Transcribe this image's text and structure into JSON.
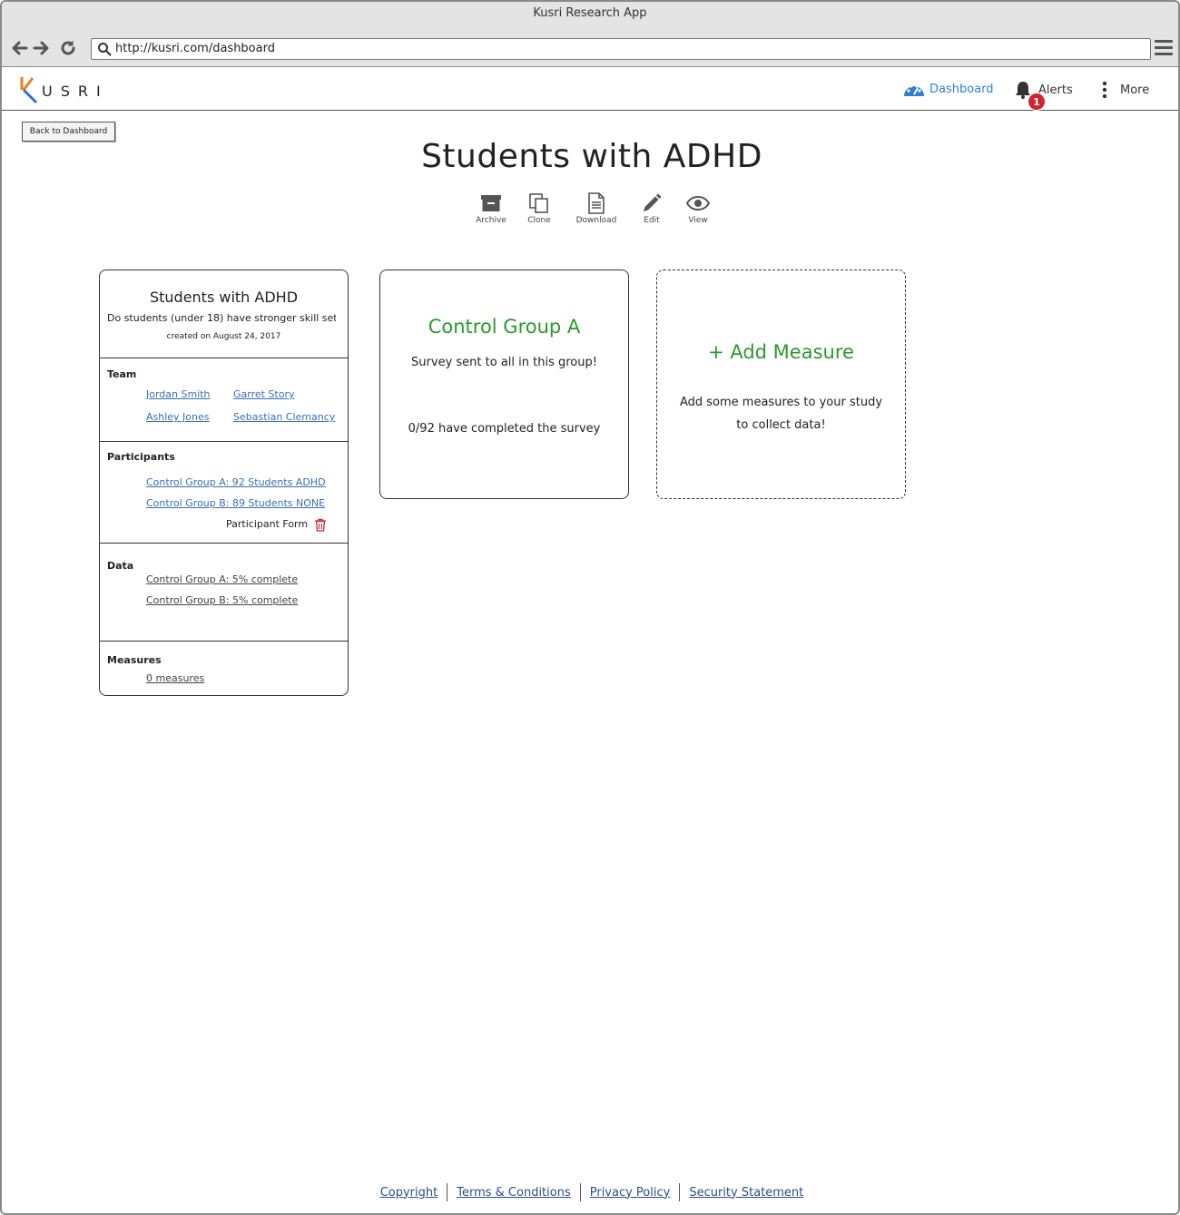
{
  "browser": {
    "window_title": "Kusri Research App",
    "url": "http://kusri.com/dashboard"
  },
  "header": {
    "logo_text": "USRI",
    "nav": {
      "dashboard": "Dashboard",
      "alerts": "Alerts",
      "alerts_count": "1",
      "more": "More"
    },
    "colors": {
      "dashboard_active": "#2f7fd3",
      "badge": "#d0242f"
    }
  },
  "page": {
    "back_button": "Back to Dashboard",
    "title": "Students with ADHD",
    "actions": {
      "archive": "Archive",
      "clone": "Clone",
      "download": "Download",
      "edit": "Edit",
      "view": "View"
    }
  },
  "study_card": {
    "title": "Students with ADHD",
    "description": "Do students (under 18) have stronger skill sets",
    "created": "created on August 24, 2017",
    "team": {
      "label": "Team",
      "members": [
        "Jordan Smith",
        "Garret Story",
        "Ashley Jones",
        "Sebastian Clemancy"
      ]
    },
    "participants": {
      "label": "Participants",
      "groups": [
        "Control Group A: 92 Students ADHD",
        "Control Group B: 89 Students NONE"
      ],
      "form_label": "Participant Form"
    },
    "data": {
      "label": "Data",
      "items": [
        "Control Group A: 5% complete",
        "Control Group B: 5% complete"
      ]
    },
    "measures": {
      "label": "Measures",
      "link": "0 measures "
    }
  },
  "group_card": {
    "title": "Control Group A",
    "status": "Survey sent to all in this group!",
    "completed": "0/92 have completed the survey",
    "accent_color": "#2b9a2b"
  },
  "add_measure_card": {
    "title": "+ Add Measure",
    "line1": "Add some measures to your study",
    "line2": "to collect data!"
  },
  "footer": {
    "links": [
      "Copyright",
      "Terms & Conditions",
      "Privacy Policy",
      "Security Statement"
    ]
  },
  "icons": {
    "back": "arrow-left-icon",
    "forward": "arrow-right-icon",
    "reload": "reload-icon",
    "search": "search-icon",
    "menu": "hamburger-icon",
    "dashboard": "speedometer-icon",
    "alerts": "bell-icon",
    "more": "vertical-dots-icon",
    "trash": "trash-icon"
  }
}
